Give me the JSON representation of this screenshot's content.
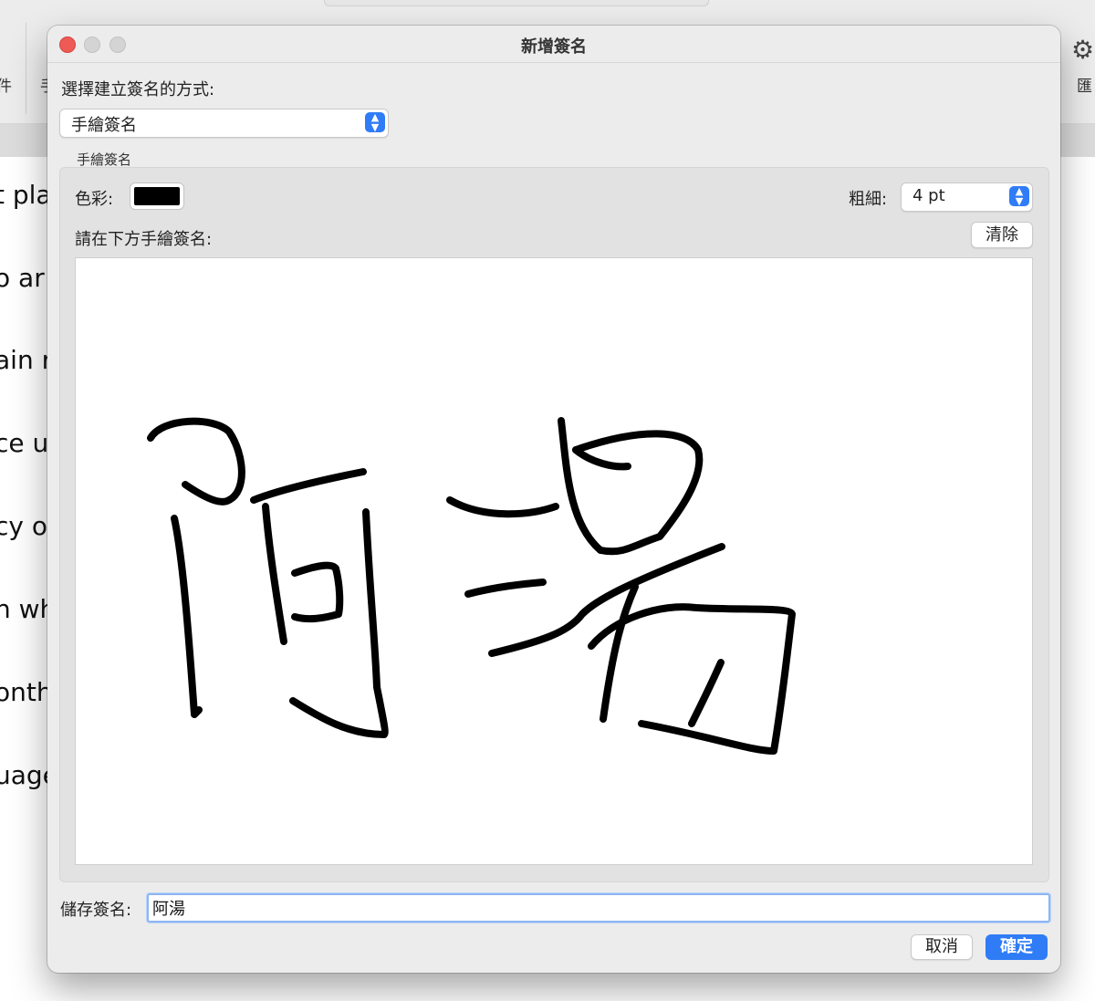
{
  "background": {
    "toolbar_labels": [
      "件",
      "手"
    ],
    "right_label": "匯",
    "doc_lines": [
      "t pla",
      "o ar",
      "ain r",
      "ce us",
      "cy o",
      "n wh",
      "onth",
      "uage"
    ]
  },
  "dialog": {
    "title": "新增簽名",
    "method_label": "選擇建立簽名的方式:",
    "method_value": "手繪簽名",
    "group_label": "手繪簽名",
    "color_label": "色彩:",
    "color_value": "#000000",
    "thickness_label": "粗細:",
    "thickness_value": "4 pt",
    "draw_instruction": "請在下方手繪簽名:",
    "clear_button": "清除",
    "save_label": "儲存簽名:",
    "save_value": "阿湯",
    "cancel_button": "取消",
    "ok_button": "確定"
  },
  "icons": {
    "gear": "gear-icon",
    "close": "close-window-icon",
    "minimize": "minimize-window-icon",
    "zoom": "zoom-window-icon",
    "stepper": "chevron-updown-icon"
  },
  "colors": {
    "accent": "#2f7cf6",
    "close_button": "#ee5b55",
    "ink": "#000000"
  }
}
